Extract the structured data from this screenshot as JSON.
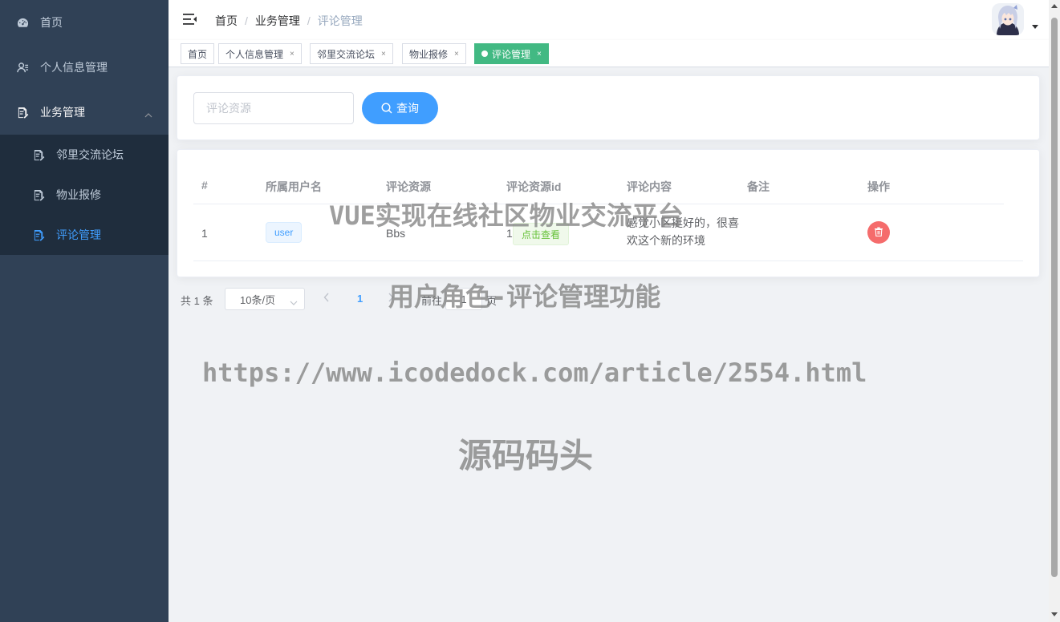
{
  "sidebar": {
    "items": [
      {
        "label": "首页",
        "icon": "dashboard-icon"
      },
      {
        "label": "个人信息管理",
        "icon": "user-info-icon"
      },
      {
        "label": "业务管理",
        "icon": "document-icon",
        "expanded": true
      }
    ],
    "submenu": [
      {
        "label": "邻里交流论坛",
        "icon": "document-icon"
      },
      {
        "label": "物业报修",
        "icon": "document-icon"
      },
      {
        "label": "评论管理",
        "icon": "document-icon",
        "active": true
      }
    ]
  },
  "header": {
    "breadcrumb": [
      "首页",
      "业务管理",
      "评论管理"
    ],
    "separator": "/"
  },
  "tags": [
    {
      "label": "首页",
      "closable": false
    },
    {
      "label": "个人信息管理",
      "closable": true
    },
    {
      "label": "邻里交流论坛",
      "closable": true
    },
    {
      "label": "物业报修",
      "closable": true
    },
    {
      "label": "评论管理",
      "closable": true,
      "active": true
    }
  ],
  "close_glyph": "×",
  "search": {
    "placeholder": "评论资源",
    "button_label": "查询"
  },
  "table": {
    "columns": [
      "#",
      "所属用户名",
      "评论资源",
      "评论资源id",
      "评论内容",
      "备注",
      "操作"
    ],
    "rows": [
      {
        "index": "1",
        "username": "user",
        "resource": "Bbs",
        "resource_id": "1",
        "view_label": "点击查看",
        "content": "感觉小区挺好的，很喜欢这个新的环境",
        "remark": ""
      }
    ]
  },
  "pagination": {
    "total_text": "共 1 条",
    "page_size": "10条/页",
    "current_page": "1",
    "goto_label": "前往",
    "jump_value": "1",
    "page_label": "页"
  },
  "watermark": {
    "line1": "VUE实现在线社区物业交流平台",
    "line2": "用户角色-评论管理功能",
    "line3": "https://www.icodedock.com/article/2554.html",
    "line4": "源码码头"
  },
  "colors": {
    "sidebar_bg": "#304156",
    "submenu_bg": "#1f2d3d",
    "primary": "#409eff",
    "active_tag": "#42b983",
    "danger": "#f56c6c",
    "success": "#67c23a"
  }
}
